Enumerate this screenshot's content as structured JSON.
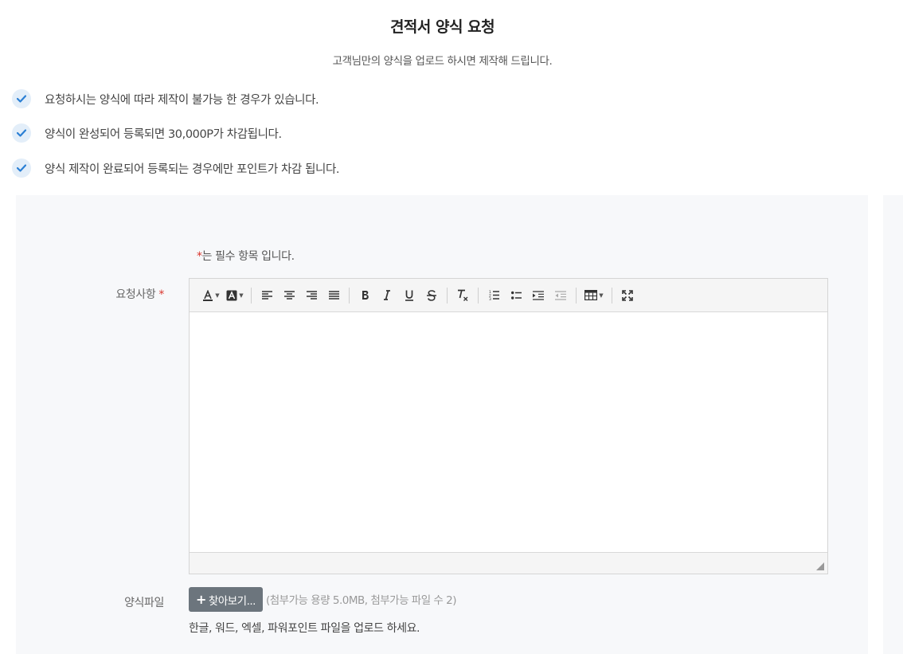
{
  "header": {
    "title": "견적서 양식 요청",
    "subtitle": "고객님만의 양식을 업로드 하시면 제작해 드립니다."
  },
  "notices": [
    "요청하시는 양식에 따라 제작이 불가능 한 경우가 있습니다.",
    "양식이 완성되어 등록되면 30,000P가 차감됩니다.",
    "양식 제작이 완료되어 등록되는 경우에만 포인트가 차감 됩니다."
  ],
  "form": {
    "required_star": "*",
    "required_note": "는 필수 항목 입니다.",
    "request_label": "요청사항",
    "file_label": "양식파일",
    "browse_label": "찾아보기...",
    "attach_hint": "(첨부가능 용량 5.0MB, 첨부가능 파일 수 2)",
    "upload_hint": "한글, 워드, 엑셀, 파워포인트 파일을 업로드 하세요."
  },
  "editor_toolbar": [
    "text-color-icon",
    "background-color-icon",
    "align-left-icon",
    "align-center-icon",
    "align-right-icon",
    "align-justify-icon",
    "bold-icon",
    "italic-icon",
    "underline-icon",
    "strikethrough-icon",
    "clear-format-icon",
    "ordered-list-icon",
    "unordered-list-icon",
    "indent-icon",
    "outdent-icon",
    "table-icon",
    "fullscreen-icon"
  ],
  "colors": {
    "accent_check": "#2b7fd4",
    "required_star": "#d9342b",
    "browse_button": "#6c757d",
    "panel_bg": "#f7f8fa"
  }
}
